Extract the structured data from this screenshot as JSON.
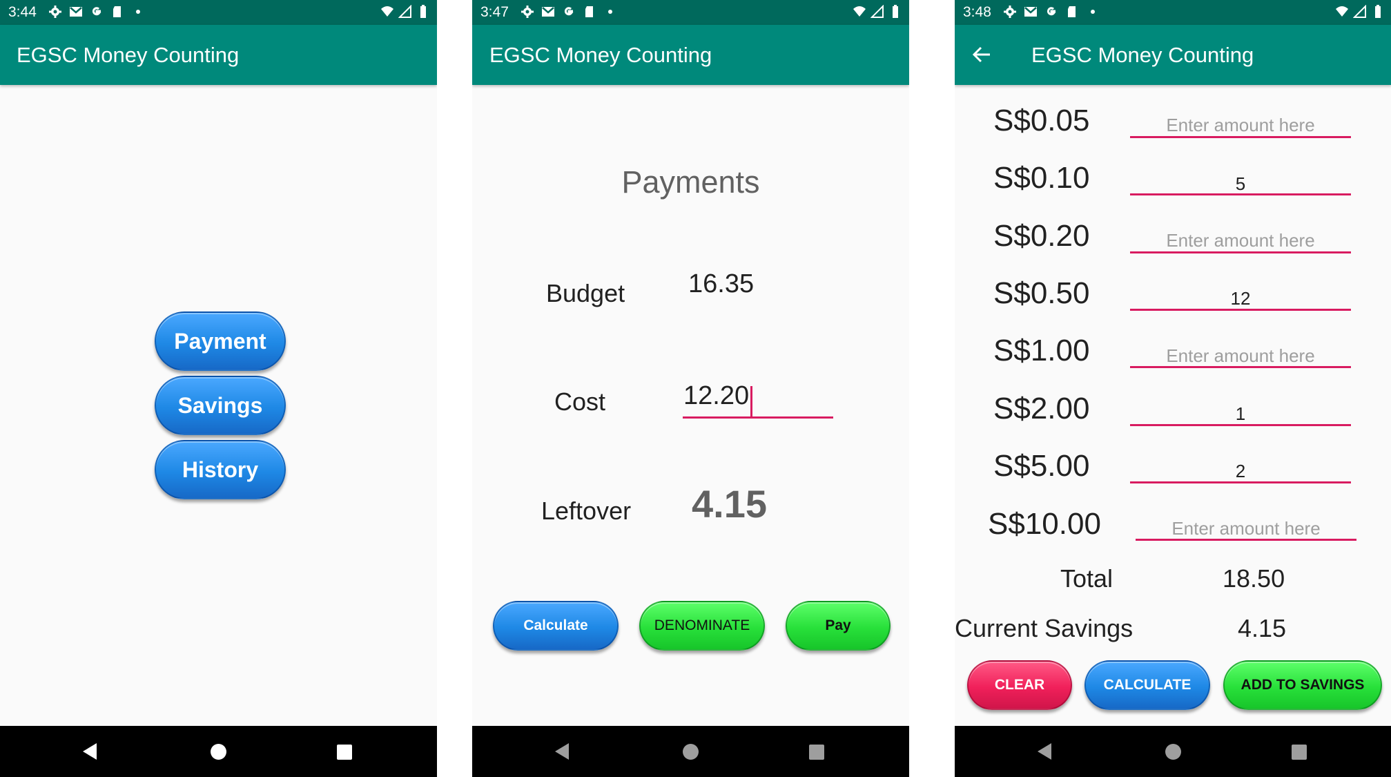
{
  "app_title": "EGSC Money Counting",
  "screens": [
    {
      "status_time": "3:44",
      "buttons": [
        "Payment",
        "Savings",
        "History"
      ]
    },
    {
      "status_time": "3:47",
      "heading": "Payments",
      "budget_label": "Budget",
      "budget_value": "16.35",
      "cost_label": "Cost",
      "cost_value": "12.20",
      "leftover_label": "Leftover",
      "leftover_value": "4.15",
      "buttons": [
        "Calculate",
        "DENOMINATE",
        "Pay"
      ]
    },
    {
      "status_time": "3:48",
      "rows": [
        {
          "denom": "S$0.05",
          "value": "",
          "placeholder": "Enter amount here"
        },
        {
          "denom": "S$0.10",
          "value": "5",
          "placeholder": "Enter amount here"
        },
        {
          "denom": "S$0.20",
          "value": "",
          "placeholder": "Enter amount here"
        },
        {
          "denom": "S$0.50",
          "value": "12",
          "placeholder": "Enter amount here"
        },
        {
          "denom": "S$1.00",
          "value": "",
          "placeholder": "Enter amount here"
        },
        {
          "denom": "S$2.00",
          "value": "1",
          "placeholder": "Enter amount here"
        },
        {
          "denom": "S$5.00",
          "value": "2",
          "placeholder": "Enter amount here"
        },
        {
          "denom": "S$10.00",
          "value": "",
          "placeholder": "Enter amount here"
        }
      ],
      "total_label": "Total",
      "total_value": "18.50",
      "savings_label": "Current Savings",
      "savings_value": "4.15",
      "buttons": [
        "CLEAR",
        "CALCULATE",
        "ADD TO SAVINGS"
      ]
    }
  ],
  "colors": {
    "status_bar": "#00695c",
    "app_bar": "#00897b",
    "accent": "#d81b60",
    "blue_button": "#1e88e5",
    "green_button": "#28e03a",
    "red_button": "#f0205a"
  },
  "status_icons": [
    "settings-icon",
    "gmail-icon",
    "google-icon",
    "sd-card-icon",
    "dot-icon",
    "wifi-icon",
    "signal-icon",
    "battery-icon"
  ],
  "nav_icons": [
    "back-icon",
    "home-icon",
    "recents-icon"
  ]
}
